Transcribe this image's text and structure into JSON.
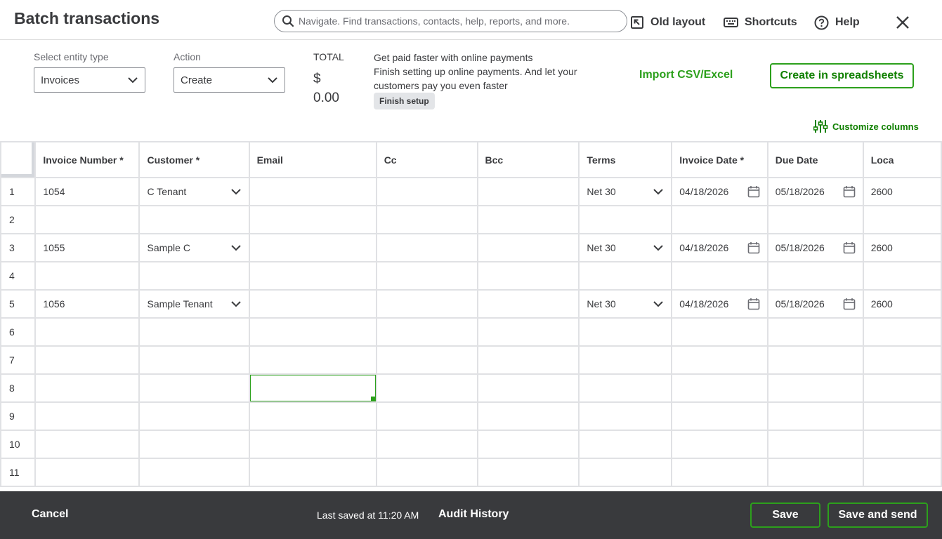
{
  "header": {
    "title": "Batch transactions",
    "search_placeholder": "Navigate. Find transactions, contacts, help, reports, and more.",
    "old_layout": "Old layout",
    "shortcuts": "Shortcuts",
    "help": "Help"
  },
  "toolbar": {
    "entity_label": "Select entity type",
    "entity_value": "Invoices",
    "action_label": "Action",
    "action_value": "Create",
    "total_label": "TOTAL",
    "total_currency": "$",
    "total_value": "0.00",
    "promo_title": "Get paid faster with online payments",
    "promo_body": "Finish setting up online payments. And let your customers pay you even faster",
    "finish_setup": "Finish setup",
    "import": "Import CSV/Excel",
    "create_spreadsheets": "Create in spreadsheets",
    "customize_columns": "Customize columns"
  },
  "grid": {
    "columns": [
      "Invoice Number *",
      "Customer *",
      "Email",
      "Cc",
      "Bcc",
      "Terms",
      "Invoice Date *",
      "Due Date",
      "Loca"
    ],
    "rows": [
      {
        "num": "1",
        "invoice": "1054",
        "customer": "C Tenant",
        "terms": "Net 30",
        "invoice_date": "04/18/2026",
        "due_date": "05/18/2026",
        "location": "2600"
      },
      {
        "num": "2"
      },
      {
        "num": "3",
        "invoice": "1055",
        "customer": "Sample C",
        "terms": "Net 30",
        "invoice_date": "04/18/2026",
        "due_date": "05/18/2026",
        "location": "2600"
      },
      {
        "num": "4"
      },
      {
        "num": "5",
        "invoice": "1056",
        "customer": "Sample Tenant",
        "terms": "Net 30",
        "invoice_date": "04/18/2026",
        "due_date": "05/18/2026",
        "location": "2600"
      },
      {
        "num": "6"
      },
      {
        "num": "7"
      },
      {
        "num": "8"
      },
      {
        "num": "9"
      },
      {
        "num": "10"
      },
      {
        "num": "11"
      }
    ]
  },
  "footer": {
    "cancel": "Cancel",
    "last_saved": "Last saved at 11:20 AM",
    "audit_history": "Audit History",
    "save": "Save",
    "save_and_send": "Save and send"
  },
  "colors": {
    "accent": "#2ca01c",
    "accent_text": "#108000",
    "footer_bg": "#393a3d",
    "grid_border": "#e0e1e4"
  }
}
